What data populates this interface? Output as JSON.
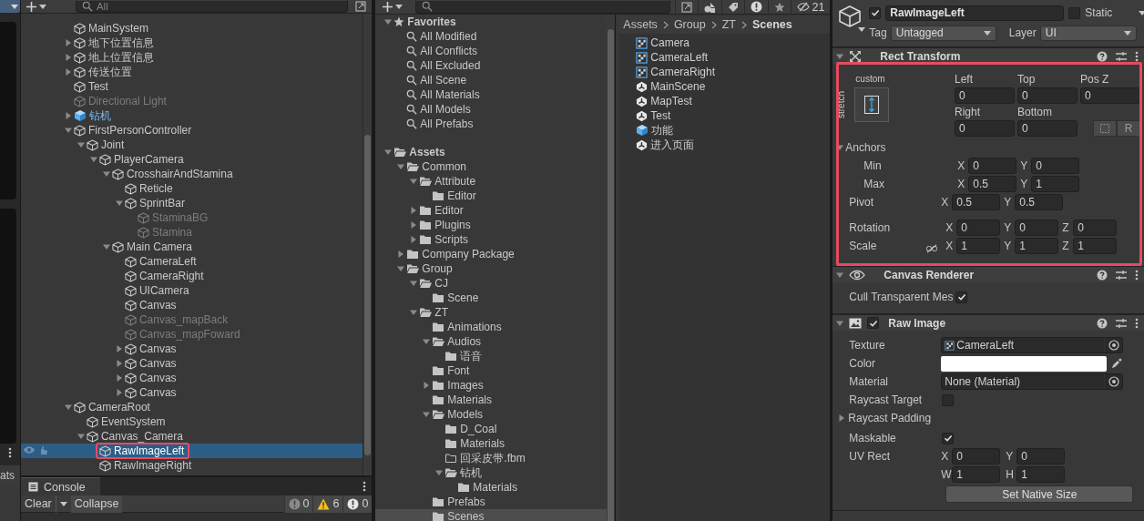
{
  "side_panel": {
    "tab_label": "ats"
  },
  "hierarchy": {
    "search": {
      "placeholder": "All"
    },
    "items": [
      {
        "name": "MainSystem",
        "kind": "object",
        "disabled": false,
        "selected": false
      },
      {
        "name": "地下位置信息",
        "kind": "object",
        "disabled": false,
        "selected": false,
        "expanded": false
      },
      {
        "name": "地上位置信息",
        "kind": "object",
        "disabled": false,
        "selected": false,
        "expanded": false
      },
      {
        "name": "传送位置",
        "kind": "object",
        "disabled": false,
        "selected": false,
        "expanded": false
      },
      {
        "name": "Test",
        "kind": "object",
        "disabled": false,
        "selected": false
      },
      {
        "name": "Directional Light",
        "kind": "object",
        "disabled": true,
        "selected": false
      },
      {
        "name": "钻机",
        "kind": "prefab",
        "disabled": false,
        "selected": false,
        "expanded": false
      },
      {
        "name": "FirstPersonController",
        "kind": "object",
        "disabled": false,
        "selected": false,
        "expanded": true,
        "children": [
          {
            "name": "Joint",
            "kind": "object",
            "disabled": false,
            "selected": false,
            "expanded": true,
            "children": [
              {
                "name": "PlayerCamera",
                "kind": "object",
                "disabled": false,
                "selected": false,
                "expanded": true,
                "children": [
                  {
                    "name": "CrosshairAndStamina",
                    "kind": "object",
                    "disabled": false,
                    "selected": false,
                    "expanded": true,
                    "children": [
                      {
                        "name": "Reticle",
                        "kind": "object",
                        "disabled": false,
                        "selected": false
                      },
                      {
                        "name": "SprintBar",
                        "kind": "object",
                        "disabled": false,
                        "selected": false,
                        "expanded": true,
                        "children": [
                          {
                            "name": "StaminaBG",
                            "kind": "object",
                            "disabled": true,
                            "selected": false
                          },
                          {
                            "name": "Stamina",
                            "kind": "object",
                            "disabled": true,
                            "selected": false
                          }
                        ]
                      }
                    ]
                  },
                  {
                    "name": "Main Camera",
                    "kind": "object",
                    "disabled": false,
                    "selected": false,
                    "expanded": true,
                    "children": [
                      {
                        "name": "CameraLeft",
                        "kind": "object",
                        "disabled": false,
                        "selected": false
                      },
                      {
                        "name": "CameraRight",
                        "kind": "object",
                        "disabled": false,
                        "selected": false
                      },
                      {
                        "name": "UICamera",
                        "kind": "object",
                        "disabled": false,
                        "selected": false
                      },
                      {
                        "name": "Canvas",
                        "kind": "object",
                        "disabled": false,
                        "selected": false
                      },
                      {
                        "name": "Canvas_mapBack",
                        "kind": "object",
                        "disabled": true,
                        "selected": false
                      },
                      {
                        "name": "Canvas_mapFoward",
                        "kind": "object",
                        "disabled": true,
                        "selected": false
                      },
                      {
                        "name": "Canvas",
                        "kind": "object",
                        "disabled": false,
                        "selected": false,
                        "expanded": false
                      },
                      {
                        "name": "Canvas",
                        "kind": "object",
                        "disabled": false,
                        "selected": false,
                        "expanded": false
                      },
                      {
                        "name": "Canvas",
                        "kind": "object",
                        "disabled": false,
                        "selected": false,
                        "expanded": false
                      },
                      {
                        "name": "Canvas",
                        "kind": "object",
                        "disabled": false,
                        "selected": false,
                        "expanded": false
                      }
                    ]
                  }
                ]
              }
            ]
          }
        ]
      },
      {
        "name": "CameraRoot",
        "kind": "object",
        "disabled": false,
        "selected": false,
        "expanded": true,
        "children": [
          {
            "name": "EventSystem",
            "kind": "object",
            "disabled": false,
            "selected": false
          },
          {
            "name": "Canvas_Camera",
            "kind": "object",
            "disabled": false,
            "selected": false,
            "expanded": true,
            "children": [
              {
                "name": "RawImageLeft",
                "kind": "object",
                "disabled": false,
                "selected": true,
                "highlighted": true
              },
              {
                "name": "RawImageRight",
                "kind": "object",
                "disabled": false,
                "selected": false
              }
            ]
          }
        ]
      }
    ]
  },
  "console": {
    "tab": "Console",
    "clear": "Clear",
    "collapse": "Collapse",
    "counts": [
      {
        "kind": "info",
        "count": "0"
      },
      {
        "kind": "warning",
        "count": "6"
      },
      {
        "kind": "error",
        "count": "0"
      }
    ]
  },
  "project": {
    "hidden_count": "21",
    "tree": [
      {
        "name": "Favorites",
        "kind": "favorites",
        "selected": false,
        "expanded": true,
        "children": [
          {
            "name": "All Modified",
            "kind": "search",
            "selected": false
          },
          {
            "name": "All Conflicts",
            "kind": "search",
            "selected": false
          },
          {
            "name": "All Excluded",
            "kind": "search",
            "selected": false
          },
          {
            "name": "All Scene",
            "kind": "search",
            "selected": false
          },
          {
            "name": "All Materials",
            "kind": "search",
            "selected": false
          },
          {
            "name": "All Models",
            "kind": "search",
            "selected": false
          },
          {
            "name": "All Prefabs",
            "kind": "search",
            "selected": false
          }
        ]
      },
      {
        "name": "Assets",
        "kind": "folder",
        "selected": false,
        "expanded": true,
        "children": [
          {
            "name": "Common",
            "kind": "folder",
            "selected": false,
            "expanded": true,
            "children": [
              {
                "name": "Attribute",
                "kind": "folder",
                "selected": false,
                "expanded": true,
                "children": [
                  {
                    "name": "Editor",
                    "kind": "folder",
                    "selected": false
                  }
                ]
              },
              {
                "name": "Editor",
                "kind": "folder",
                "selected": false,
                "expanded": false
              },
              {
                "name": "Plugins",
                "kind": "folder",
                "selected": false,
                "expanded": false
              },
              {
                "name": "Scripts",
                "kind": "folder",
                "selected": false,
                "expanded": false
              }
            ]
          },
          {
            "name": "Company Package",
            "kind": "folder",
            "selected": false,
            "expanded": false
          },
          {
            "name": "Group",
            "kind": "folder",
            "selected": false,
            "expanded": true,
            "children": [
              {
                "name": "CJ",
                "kind": "folder",
                "selected": false,
                "expanded": true,
                "children": [
                  {
                    "name": "Scene",
                    "kind": "folder",
                    "selected": false
                  }
                ]
              },
              {
                "name": "ZT",
                "kind": "folder",
                "selected": false,
                "expanded": true,
                "children": [
                  {
                    "name": "Animations",
                    "kind": "folder",
                    "selected": false
                  },
                  {
                    "name": "Audios",
                    "kind": "folder",
                    "selected": false,
                    "expanded": true,
                    "children": [
                      {
                        "name": "语音",
                        "kind": "folder",
                        "selected": false
                      }
                    ]
                  },
                  {
                    "name": "Font",
                    "kind": "folder",
                    "selected": false
                  },
                  {
                    "name": "Images",
                    "kind": "folder",
                    "selected": false,
                    "expanded": false
                  },
                  {
                    "name": "Materials",
                    "kind": "folder",
                    "selected": false
                  },
                  {
                    "name": "Models",
                    "kind": "folder",
                    "selected": false,
                    "expanded": true,
                    "children": [
                      {
                        "name": "D_Coal",
                        "kind": "folder",
                        "selected": false
                      },
                      {
                        "name": "Materials",
                        "kind": "folder",
                        "selected": false
                      },
                      {
                        "name": "回采皮带.fbm",
                        "kind": "empty_folder",
                        "selected": false
                      },
                      {
                        "name": "钻机",
                        "kind": "folder",
                        "selected": false,
                        "expanded": true,
                        "children": [
                          {
                            "name": "Materials",
                            "kind": "folder",
                            "selected": false
                          }
                        ]
                      }
                    ]
                  },
                  {
                    "name": "Prefabs",
                    "kind": "folder",
                    "selected": false
                  },
                  {
                    "name": "Scenes",
                    "kind": "folder",
                    "selected": true
                  }
                ]
              }
            ]
          }
        ]
      }
    ],
    "breadcrumb": [
      "Assets",
      "Group",
      "ZT",
      "Scenes"
    ],
    "files": [
      {
        "name": "Camera",
        "kind": "render_texture"
      },
      {
        "name": "CameraLeft",
        "kind": "render_texture"
      },
      {
        "name": "CameraRight",
        "kind": "render_texture"
      },
      {
        "name": "MainScene",
        "kind": "scene"
      },
      {
        "name": "MapTest",
        "kind": "scene"
      },
      {
        "name": "Test",
        "kind": "scene"
      },
      {
        "name": "功能",
        "kind": "prefab"
      },
      {
        "name": "进入页面",
        "kind": "scene"
      }
    ]
  },
  "inspector": {
    "active": true,
    "name": "RawImageLeft",
    "static": false,
    "static_label": "Static",
    "tag_label": "Tag",
    "tag": "Untagged",
    "layer_label": "Layer",
    "layer": "UI",
    "components": [
      {
        "kind": "rect_transform",
        "title": "Rect Transform",
        "highlighted": true,
        "preset": {
          "horizontal": "custom",
          "vertical": "stretch"
        },
        "fields": [
          {
            "label": "Left",
            "value": "0"
          },
          {
            "label": "Top",
            "value": "0"
          },
          {
            "label": "Pos Z",
            "value": "0"
          },
          {
            "label": "Right",
            "value": "0"
          },
          {
            "label": "Bottom",
            "value": "0"
          }
        ],
        "raw_edit_label": "R",
        "anchors": {
          "label": "Anchors",
          "expanded": true,
          "rows": [
            {
              "label": "Min",
              "values": [
                {
                  "axis": "X",
                  "value": "0"
                },
                {
                  "axis": "Y",
                  "value": "0"
                }
              ]
            },
            {
              "label": "Max",
              "values": [
                {
                  "axis": "X",
                  "value": "0.5"
                },
                {
                  "axis": "Y",
                  "value": "1"
                }
              ]
            }
          ]
        },
        "vectors": [
          {
            "label": "Pivot",
            "values": [
              {
                "axis": "X",
                "value": "0.5"
              },
              {
                "axis": "Y",
                "value": "0.5"
              }
            ]
          },
          {
            "label": "Rotation",
            "values": [
              {
                "axis": "X",
                "value": "0"
              },
              {
                "axis": "Y",
                "value": "0"
              },
              {
                "axis": "Z",
                "value": "0"
              }
            ]
          },
          {
            "label": "Scale",
            "linked": false,
            "values": [
              {
                "axis": "X",
                "value": "1"
              },
              {
                "axis": "Y",
                "value": "1"
              },
              {
                "axis": "Z",
                "value": "1"
              }
            ]
          }
        ]
      },
      {
        "kind": "canvas_renderer",
        "title": "Canvas Renderer",
        "props": [
          {
            "kind": "checkbox",
            "label": "Cull Transparent Mes",
            "checked": true
          }
        ]
      },
      {
        "kind": "raw_image",
        "title": "Raw Image",
        "enabled": true,
        "props": [
          {
            "kind": "texture",
            "label": "Texture",
            "value": "CameraLeft"
          },
          {
            "kind": "color",
            "label": "Color",
            "color": "#ffffff"
          },
          {
            "kind": "object",
            "label": "Material",
            "value": "None (Material)"
          },
          {
            "kind": "checkbox",
            "label": "Raycast Target",
            "checked": false
          },
          {
            "kind": "foldout",
            "label": "Raycast Padding",
            "expanded": false
          },
          {
            "kind": "checkbox",
            "label": "Maskable",
            "checked": true
          },
          {
            "kind": "rect",
            "label": "UV Rect",
            "values": [
              {
                "axis": "X",
                "value": "0"
              },
              {
                "axis": "Y",
                "value": "0"
              },
              {
                "axis": "W",
                "value": "1"
              },
              {
                "axis": "H",
                "value": "1"
              }
            ]
          }
        ],
        "button": "Set Native Size"
      }
    ]
  }
}
